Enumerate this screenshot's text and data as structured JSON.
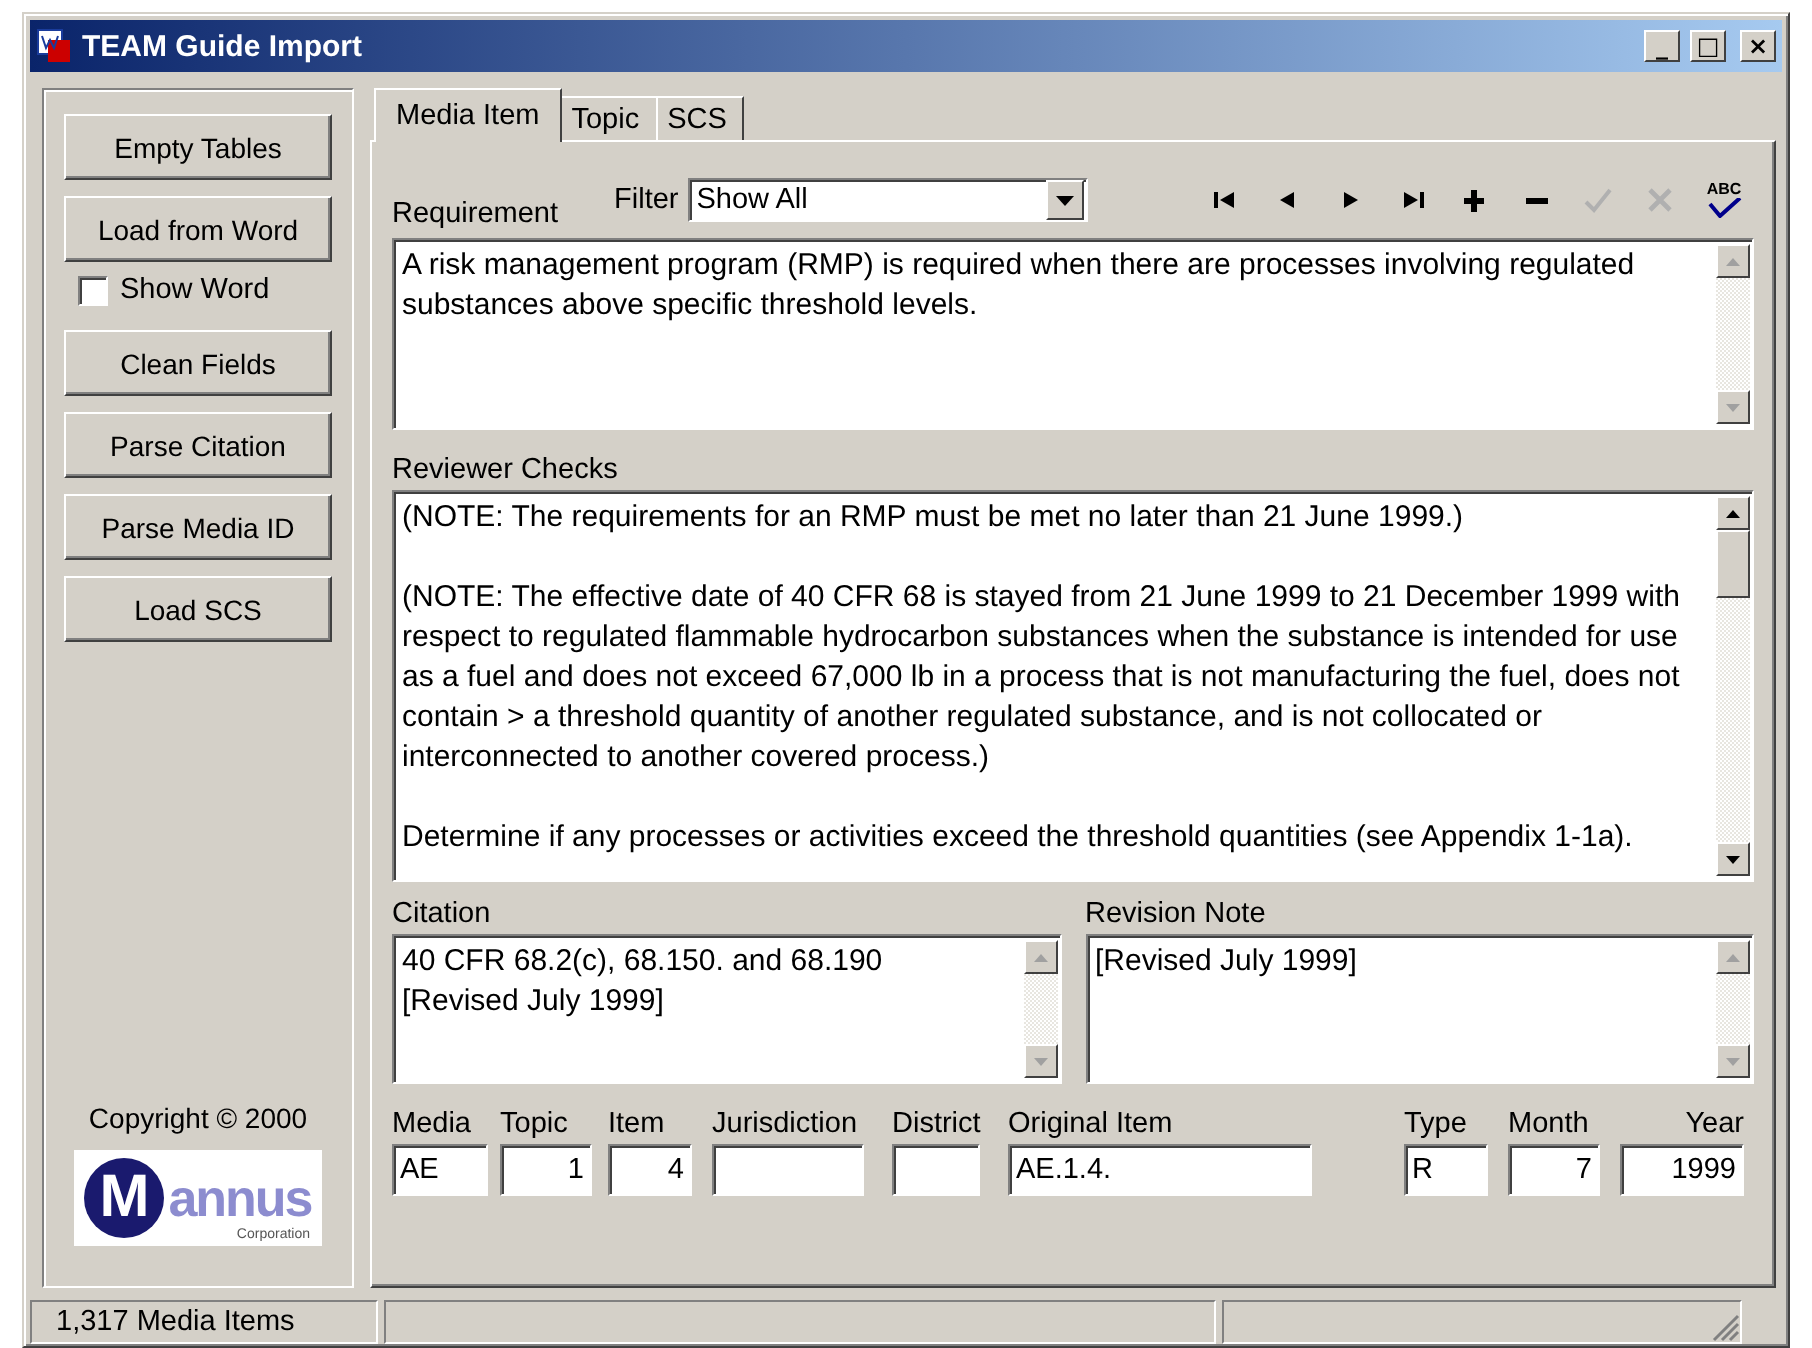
{
  "window": {
    "title": "TEAM Guide Import",
    "controls": [
      "_",
      "□",
      "×"
    ]
  },
  "sidebar": {
    "buttons": [
      "Empty Tables",
      "Load from Word"
    ],
    "show_word": {
      "label": "Show Word",
      "checked": false
    },
    "buttons_2": [
      "Clean Fields",
      "Parse Citation",
      "Parse Media ID",
      "Load SCS"
    ],
    "copyright": "Copyright © 2000",
    "logo": {
      "initial": "M",
      "name": "annus",
      "sub": "Corporation"
    }
  },
  "tabs": [
    {
      "label": "Media Item",
      "selected": true
    },
    {
      "label": "Topic",
      "selected": false
    },
    {
      "label": "SCS",
      "selected": false
    }
  ],
  "requirement": {
    "label": "Requirement",
    "text": "A risk management program (RMP) is required when there are processes involving regulated substances above specific threshold levels."
  },
  "filter": {
    "label": "Filter",
    "value": "Show All"
  },
  "toolbar": [
    {
      "kind": "first",
      "disabled": false
    },
    {
      "kind": "prev",
      "disabled": false
    },
    {
      "kind": "next",
      "disabled": false
    },
    {
      "kind": "last",
      "disabled": false
    },
    {
      "kind": "add",
      "disabled": false
    },
    {
      "kind": "remove",
      "disabled": false
    },
    {
      "kind": "save",
      "disabled": true
    },
    {
      "kind": "cancel",
      "disabled": true
    },
    {
      "kind": "spell",
      "disabled": false,
      "text": "ABC"
    }
  ],
  "reviewer_checks": {
    "label": "Reviewer Checks",
    "paragraphs": [
      "(NOTE:  The requirements for an RMP must be met no later than 21 June 1999.)",
      "(NOTE: The effective date of 40 CFR 68 is stayed from 21 June 1999 to 21 December 1999 with respect to regulated flammable hydrocarbon substances when the substance is intended for use as a fuel and does not exceed 67,000 lb in a process that is not manufacturing the fuel, does not contain > a threshold quantity of another regulated substance, and is not collocated or interconnected to another covered process.)",
      "Determine if any processes or activities exceed the threshold quantities (see Appendix 1-1a)."
    ]
  },
  "citation": {
    "label": "Citation",
    "text": "40 CFR 68.2(c), 68.150. and 68.190\n[Revised July 1999]"
  },
  "revision_note": {
    "label": "Revision Note",
    "text": "[Revised July 1999]"
  },
  "fields": [
    {
      "label": "Media",
      "value": "AE",
      "kind": "text"
    },
    {
      "label": "Topic",
      "value": "1",
      "kind": "number"
    },
    {
      "label": "Item",
      "value": "4",
      "kind": "number"
    },
    {
      "label": "Jurisdiction",
      "kind": "text"
    },
    {
      "label": "District",
      "kind": "text"
    },
    {
      "label": "Original Item",
      "value": "AE.1.4.",
      "kind": "text"
    },
    {
      "label": "Type",
      "value": "R",
      "kind": "text"
    },
    {
      "label": "Month",
      "value": "7",
      "kind": "number"
    },
    {
      "label": "Year",
      "value": "1999",
      "kind": "number"
    }
  ],
  "status_bar": [
    "1,317 Media Items"
  ]
}
